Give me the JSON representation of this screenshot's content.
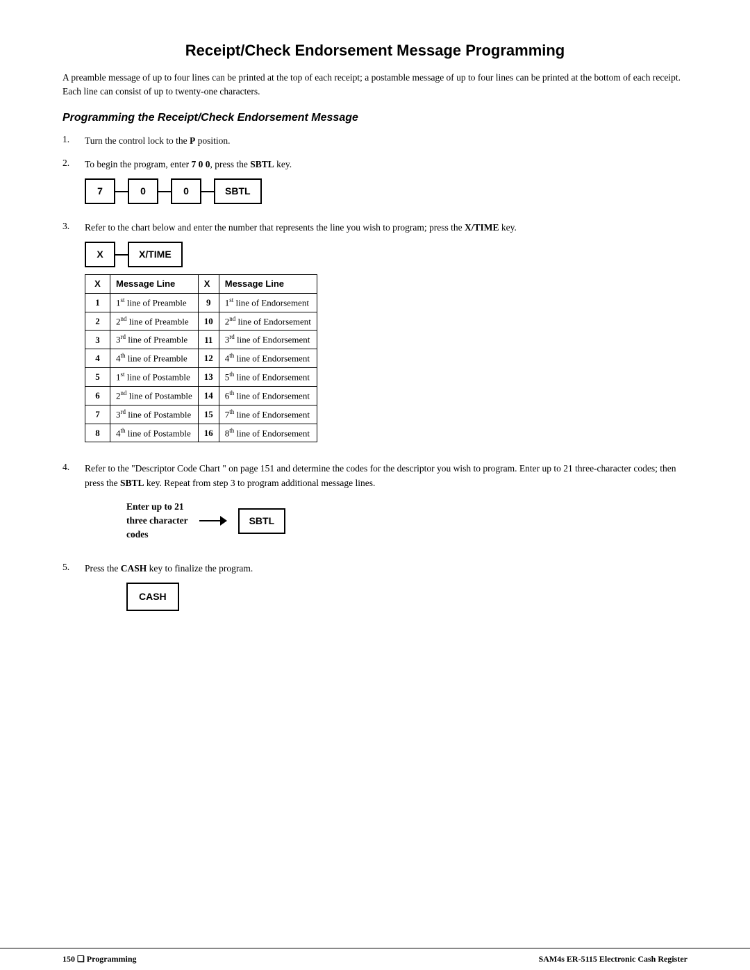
{
  "page": {
    "title": "Receipt/Check Endorsement Message Programming",
    "intro": "A preamble message of up to four lines can be printed at the top of each receipt; a postamble message of up to four lines can be printed at the bottom of each receipt.  Each line can consist of up to twenty-one characters.",
    "section_title": "Programming the Receipt/Check Endorsement Message",
    "steps": [
      {
        "number": "1.",
        "text": "Turn the control lock to the ",
        "bold": "P",
        "text2": " position."
      },
      {
        "number": "2.",
        "text": "To begin the program, enter ",
        "bold": "7 0 0",
        "text2": ", press the ",
        "bold2": "SBTL",
        "text3": " key."
      },
      {
        "number": "3.",
        "text": "Refer to the chart below and enter the number that represents the line you wish to program; press the ",
        "bold": "X/TIME",
        "text2": " key."
      },
      {
        "number": "4.",
        "text": "Refer to the \"Descriptor Code Chart \" on page 151 and determine the codes for the descriptor you wish to program.  Enter up to 21 three-character codes; then press the ",
        "bold": "SBTL",
        "text2": " key.  Repeat from step 3 to program additional message lines."
      },
      {
        "number": "5.",
        "text": "Press the ",
        "bold": "CASH",
        "text2": " key to finalize the program."
      }
    ],
    "key_sequence_step2": [
      "7",
      "0",
      "0",
      "SBTL"
    ],
    "key_sequence_step3": [
      "X",
      "X/TIME"
    ],
    "table": {
      "headers": [
        "X",
        "Message Line",
        "X",
        "Message Line"
      ],
      "rows": [
        {
          "x1": "1",
          "msg1": [
            "1",
            "st",
            " line of Preamble"
          ],
          "x2": "9",
          "msg2": [
            "1",
            "st",
            " line of Endorsement"
          ]
        },
        {
          "x1": "2",
          "msg1": [
            "2",
            "nd",
            " line of Preamble"
          ],
          "x2": "10",
          "msg2": [
            "2",
            "nd",
            " line of Endorsement"
          ]
        },
        {
          "x1": "3",
          "msg1": [
            "3",
            "rd",
            " line of Preamble"
          ],
          "x2": "11",
          "msg2": [
            "3",
            "rd",
            " line of Endorsement"
          ]
        },
        {
          "x1": "4",
          "msg1": [
            "4",
            "th",
            " line of Preamble"
          ],
          "x2": "12",
          "msg2": [
            "4",
            "th",
            " line of Endorsement"
          ]
        },
        {
          "x1": "5",
          "msg1": [
            "1",
            "st",
            " line of Postamble"
          ],
          "x2": "13",
          "msg2": [
            "5",
            "th",
            " line of Endorsement"
          ]
        },
        {
          "x1": "6",
          "msg1": [
            "2",
            "nd",
            " line of Postamble"
          ],
          "x2": "14",
          "msg2": [
            "6",
            "th",
            " line of Endorsement"
          ]
        },
        {
          "x1": "7",
          "msg1": [
            "3",
            "rd",
            " line of Postamble"
          ],
          "x2": "15",
          "msg2": [
            "7",
            "th",
            " line of Endorsement"
          ]
        },
        {
          "x1": "8",
          "msg1": [
            "4",
            "th",
            " line of Postamble"
          ],
          "x2": "16",
          "msg2": [
            "8",
            "th",
            " line of Endorsement"
          ]
        }
      ]
    },
    "enter_up_text": "Enter up to 21\nthree character\ncodes",
    "sbtl_key": "SBTL",
    "cash_key": "CASH",
    "footer": {
      "left": "150  ❑  Programming",
      "right": "SAM4s ER-5115 Electronic Cash Register"
    }
  }
}
